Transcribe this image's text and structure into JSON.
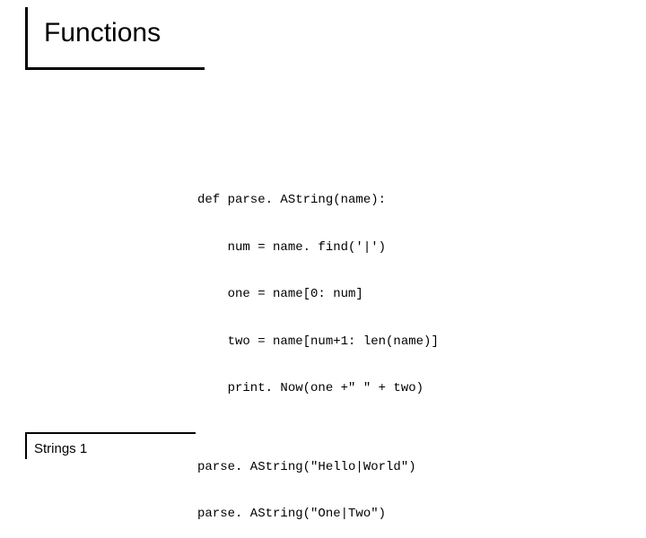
{
  "title": "Functions",
  "code": {
    "lines": [
      "def parse. AString(name):",
      "    num = name. find('|')",
      "    one = name[0: num]",
      "    two = name[num+1: len(name)]",
      "    print. Now(one +\" \" + two)",
      "",
      "parse. AString(\"Hello|World\")",
      "parse. AString(\"One|Two\")"
    ]
  },
  "footer": "Strings 1"
}
